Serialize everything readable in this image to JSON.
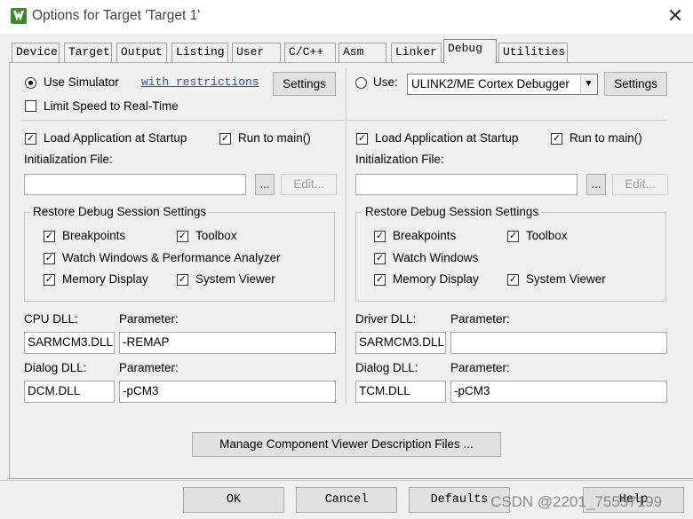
{
  "window": {
    "title": "Options for Target 'Target 1'",
    "close_glyph": "✕"
  },
  "tabs": [
    {
      "label": "Device"
    },
    {
      "label": "Target"
    },
    {
      "label": "Output"
    },
    {
      "label": "Listing"
    },
    {
      "label": "User"
    },
    {
      "label": "C/C++"
    },
    {
      "label": "Asm"
    },
    {
      "label": "Linker"
    },
    {
      "label": "Debug",
      "active": true
    },
    {
      "label": "Utilities"
    }
  ],
  "left": {
    "use_simulator_label": "Use Simulator",
    "use_simulator_selected": true,
    "with_restrictions_link": "with restrictions",
    "settings_button": "Settings",
    "limit_speed_label": "Limit Speed to Real-Time",
    "limit_speed_checked": false,
    "load_app_label": "Load Application at Startup",
    "run_to_main_label": "Run to main()",
    "init_file_label": "Initialization File:",
    "init_file_value": "",
    "browse_button": "...",
    "edit_button": "Edit...",
    "restore_group_title": "Restore Debug Session Settings",
    "breakpoints_label": "Breakpoints",
    "toolbox_label": "Toolbox",
    "watch_label": "Watch Windows & Performance Analyzer",
    "memory_label": "Memory Display",
    "system_viewer_label": "System Viewer",
    "cpu_dll_label": "CPU DLL:",
    "cpu_dll_value": "SARMCM3.DLL",
    "cpu_param_label": "Parameter:",
    "cpu_param_value": "-REMAP",
    "dialog_dll_label": "Dialog DLL:",
    "dialog_dll_value": "DCM.DLL",
    "dialog_param_label": "Parameter:",
    "dialog_param_value": "-pCM3"
  },
  "right": {
    "use_label": "Use:",
    "use_selected": false,
    "debugger_value": "ULINK2/ME Cortex Debugger",
    "settings_button": "Settings",
    "load_app_label": "Load Application at Startup",
    "run_to_main_label": "Run to main()",
    "init_file_label": "Initialization File:",
    "init_file_value": "",
    "browse_button": "...",
    "edit_button": "Edit...",
    "restore_group_title": "Restore Debug Session Settings",
    "breakpoints_label": "Breakpoints",
    "toolbox_label": "Toolbox",
    "watch_label": "Watch Windows",
    "memory_label": "Memory Display",
    "system_viewer_label": "System Viewer",
    "driver_dll_label": "Driver DLL:",
    "driver_dll_value": "SARMCM3.DLL",
    "driver_param_label": "Parameter:",
    "driver_param_value": "",
    "dialog_dll_label": "Dialog DLL:",
    "dialog_dll_value": "TCM.DLL",
    "dialog_param_label": "Parameter:",
    "dialog_param_value": "-pCM3"
  },
  "manage_button": "Manage Component Viewer Description Files ...",
  "footer": {
    "ok": "OK",
    "cancel": "Cancel",
    "defaults": "Defaults",
    "help": "Help"
  },
  "watermark": "CSDN @2201_75557199",
  "check_glyph": "✓",
  "colors": {
    "window_bg": "#f0f0f0",
    "link": "#1a4fd8",
    "icon_green": "#3a8a2a"
  }
}
